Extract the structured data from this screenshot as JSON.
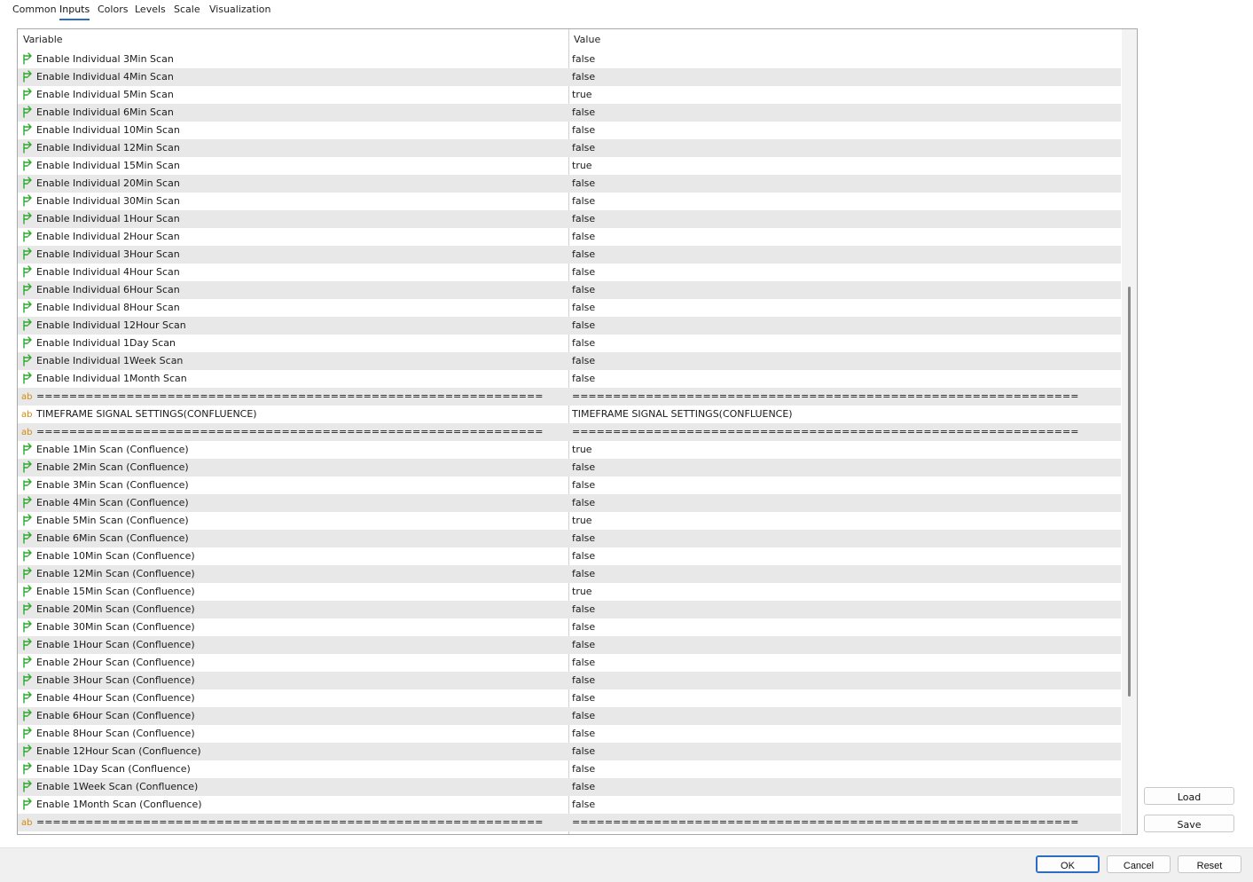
{
  "tabs": [
    "Common",
    "Inputs",
    "Colors",
    "Levels",
    "Scale",
    "Visualization"
  ],
  "active_tab": "Inputs",
  "grid": {
    "headers": {
      "variable": "Variable",
      "value": "Value"
    },
    "rows": [
      {
        "icon": "bool",
        "variable": "Enable Individual 3Min Scan",
        "value": "false"
      },
      {
        "icon": "bool",
        "variable": "Enable Individual 4Min Scan",
        "value": "false"
      },
      {
        "icon": "bool",
        "variable": "Enable Individual 5Min Scan",
        "value": "true"
      },
      {
        "icon": "bool",
        "variable": "Enable Individual 6Min Scan",
        "value": "false"
      },
      {
        "icon": "bool",
        "variable": "Enable Individual 10Min Scan",
        "value": "false"
      },
      {
        "icon": "bool",
        "variable": "Enable Individual 12Min Scan",
        "value": "false"
      },
      {
        "icon": "bool",
        "variable": "Enable Individual 15Min Scan",
        "value": "true"
      },
      {
        "icon": "bool",
        "variable": "Enable Individual 20Min Scan",
        "value": "false"
      },
      {
        "icon": "bool",
        "variable": "Enable Individual 30Min Scan",
        "value": "false"
      },
      {
        "icon": "bool",
        "variable": "Enable Individual 1Hour Scan",
        "value": "false"
      },
      {
        "icon": "bool",
        "variable": "Enable Individual 2Hour Scan",
        "value": "false"
      },
      {
        "icon": "bool",
        "variable": "Enable Individual 3Hour Scan",
        "value": "false"
      },
      {
        "icon": "bool",
        "variable": "Enable Individual 4Hour Scan",
        "value": "false"
      },
      {
        "icon": "bool",
        "variable": "Enable Individual 6Hour Scan",
        "value": "false"
      },
      {
        "icon": "bool",
        "variable": "Enable Individual 8Hour Scan",
        "value": "false"
      },
      {
        "icon": "bool",
        "variable": "Enable Individual 12Hour Scan",
        "value": "false"
      },
      {
        "icon": "bool",
        "variable": "Enable Individual 1Day Scan",
        "value": "false"
      },
      {
        "icon": "bool",
        "variable": "Enable Individual 1Week Scan",
        "value": "false"
      },
      {
        "icon": "bool",
        "variable": "Enable Individual 1Month Scan",
        "value": "false"
      },
      {
        "icon": "string",
        "variable": "==============================================================",
        "value": "=============================================================="
      },
      {
        "icon": "string",
        "variable": "TIMEFRAME SIGNAL SETTINGS(CONFLUENCE)",
        "value": "TIMEFRAME SIGNAL SETTINGS(CONFLUENCE)"
      },
      {
        "icon": "string",
        "variable": "==============================================================",
        "value": "=============================================================="
      },
      {
        "icon": "bool",
        "variable": "Enable 1Min Scan (Confluence)",
        "value": "true"
      },
      {
        "icon": "bool",
        "variable": "Enable 2Min Scan (Confluence)",
        "value": "false"
      },
      {
        "icon": "bool",
        "variable": "Enable 3Min Scan (Confluence)",
        "value": "false"
      },
      {
        "icon": "bool",
        "variable": "Enable 4Min Scan (Confluence)",
        "value": "false"
      },
      {
        "icon": "bool",
        "variable": "Enable 5Min Scan (Confluence)",
        "value": "true"
      },
      {
        "icon": "bool",
        "variable": "Enable 6Min Scan (Confluence)",
        "value": "false"
      },
      {
        "icon": "bool",
        "variable": "Enable 10Min Scan (Confluence)",
        "value": "false"
      },
      {
        "icon": "bool",
        "variable": "Enable 12Min Scan (Confluence)",
        "value": "false"
      },
      {
        "icon": "bool",
        "variable": "Enable 15Min Scan (Confluence)",
        "value": "true"
      },
      {
        "icon": "bool",
        "variable": "Enable 20Min Scan (Confluence)",
        "value": "false"
      },
      {
        "icon": "bool",
        "variable": "Enable 30Min Scan (Confluence)",
        "value": "false"
      },
      {
        "icon": "bool",
        "variable": "Enable 1Hour Scan (Confluence)",
        "value": "false"
      },
      {
        "icon": "bool",
        "variable": "Enable 2Hour Scan (Confluence)",
        "value": "false"
      },
      {
        "icon": "bool",
        "variable": "Enable 3Hour Scan (Confluence)",
        "value": "false"
      },
      {
        "icon": "bool",
        "variable": "Enable 4Hour Scan (Confluence)",
        "value": "false"
      },
      {
        "icon": "bool",
        "variable": "Enable 6Hour Scan (Confluence)",
        "value": "false"
      },
      {
        "icon": "bool",
        "variable": "Enable 8Hour Scan (Confluence)",
        "value": "false"
      },
      {
        "icon": "bool",
        "variable": "Enable 12Hour Scan (Confluence)",
        "value": "false"
      },
      {
        "icon": "bool",
        "variable": "Enable 1Day Scan (Confluence)",
        "value": "false"
      },
      {
        "icon": "bool",
        "variable": "Enable 1Week Scan (Confluence)",
        "value": "false"
      },
      {
        "icon": "bool",
        "variable": "Enable 1Month Scan (Confluence)",
        "value": "false"
      },
      {
        "icon": "string",
        "variable": "==============================================================",
        "value": "=============================================================="
      }
    ]
  },
  "side_buttons": {
    "load": "Load",
    "save": "Save"
  },
  "dialog_buttons": {
    "ok": "OK",
    "cancel": "Cancel",
    "reset": "Reset"
  },
  "colors": {
    "accent": "#2b6cc4",
    "bool_icon": "#2ea82e",
    "string_icon": "#d28b10",
    "row_alt": "#e8e8e8"
  }
}
